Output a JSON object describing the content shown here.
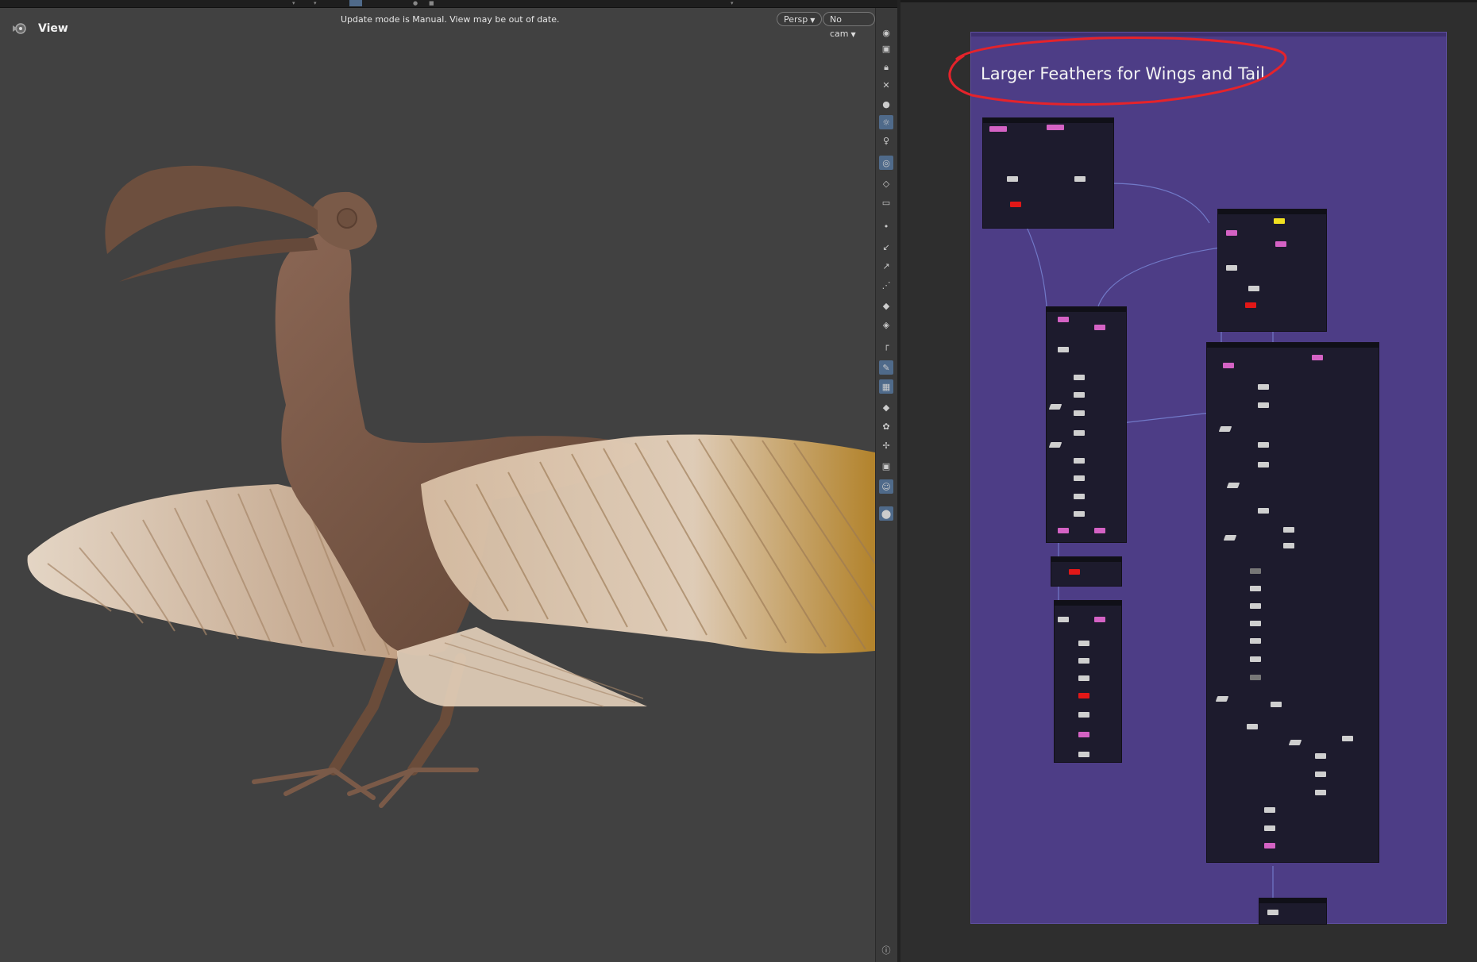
{
  "viewport": {
    "title": "View",
    "status_message": "Update mode is Manual. View may be out of date.",
    "camera_mode": "Persp",
    "camera": "No cam"
  },
  "network": {
    "netbox_title": "Larger Feathers for Wings and Tail"
  },
  "colors": {
    "viewport_bg": "#414141",
    "netbox_bg": "#4d3d86",
    "annotation_red": "#e5232b",
    "body_brown": "#7a5a48",
    "feather_light": "#e8d6c2",
    "feather_gold": "#b88a2c"
  },
  "icons": [
    "view-gear-icon",
    "eye-icon",
    "select-icon",
    "lock-icon",
    "ghost-icon",
    "shading-icon",
    "light-icon",
    "camera-icon",
    "point-icon",
    "brush-icon",
    "pen-icon",
    "measure-icon",
    "info-icon"
  ]
}
